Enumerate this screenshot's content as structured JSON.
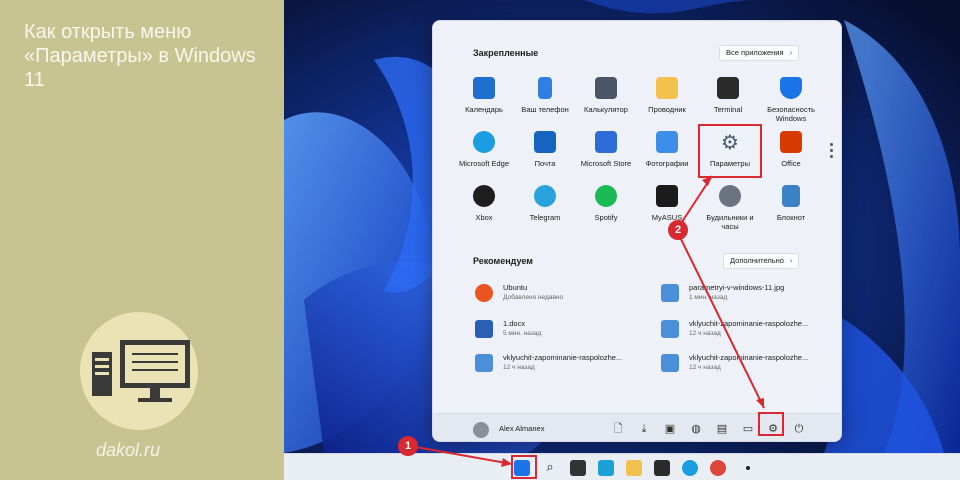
{
  "article": {
    "title": "Как открыть меню «Параметры» в Windows 11",
    "site": "dakol.ru"
  },
  "start_menu": {
    "pinned_title": "Закрепленные",
    "all_apps_label": "Все приложения",
    "pinned_apps": [
      {
        "label": "Календарь",
        "icon": "calendar-icon",
        "color": "#1f6fd1"
      },
      {
        "label": "Ваш телефон",
        "icon": "phone-icon",
        "color": "#2f7fe0"
      },
      {
        "label": "Калькулятор",
        "icon": "calculator-icon",
        "color": "#4a5568"
      },
      {
        "label": "Проводник",
        "icon": "folder-icon",
        "color": "#f2c14e"
      },
      {
        "label": "Terminal",
        "icon": "terminal-icon",
        "color": "#2b2b2b"
      },
      {
        "label": "Безопасность Windows",
        "icon": "shield-icon",
        "color": "#1a73e8"
      },
      {
        "label": "Microsoft Edge",
        "icon": "edge-icon",
        "color": "#1b9de2"
      },
      {
        "label": "Почта",
        "icon": "mail-icon",
        "color": "#1565c0"
      },
      {
        "label": "Microsoft Store",
        "icon": "store-icon",
        "color": "#2d6bd6"
      },
      {
        "label": "Фотографии",
        "icon": "photos-icon",
        "color": "#3d8ee8"
      },
      {
        "label": "Параметры",
        "icon": "gear-icon",
        "color": "#5a6a80"
      },
      {
        "label": "Office",
        "icon": "office-icon",
        "color": "#d83b01"
      },
      {
        "label": "Xbox",
        "icon": "xbox-icon",
        "color": "#1e1e1e"
      },
      {
        "label": "Telegram",
        "icon": "telegram-icon",
        "color": "#2aa3dd"
      },
      {
        "label": "Spotify",
        "icon": "spotify-icon",
        "color": "#1db954"
      },
      {
        "label": "MyASUS",
        "icon": "asus-icon",
        "color": "#1b1b1b"
      },
      {
        "label": "Будильники и часы",
        "icon": "clock-icon",
        "color": "#6b7280"
      },
      {
        "label": "Блокнот",
        "icon": "notepad-icon",
        "color": "#3b82c4"
      }
    ],
    "recommended_title": "Рекомендуем",
    "more_label": "Дополнительно",
    "recommended": [
      {
        "name": "Ubuntu",
        "time": "Добавлено недавно",
        "icon": "ubuntu-icon",
        "color": "#e95420"
      },
      {
        "name": "parametryi-v-windows-11.jpg",
        "time": "1 мин. назад",
        "icon": "image-file-icon",
        "color": "#4a8fd8"
      },
      {
        "name": "1.docx",
        "time": "5 мин. назад",
        "icon": "word-icon",
        "color": "#2b5fb4"
      },
      {
        "name": "vklyuchit-zapominanie-raspolozhe...",
        "time": "12 ч назад",
        "icon": "image-file-icon",
        "color": "#4a8fd8"
      },
      {
        "name": "vklyuchit-zapominanie-raspolozhe...",
        "time": "12 ч назад",
        "icon": "image-file-icon",
        "color": "#4a8fd8"
      },
      {
        "name": "vklyuchit-zapominanie-raspolozhe...",
        "time": "12 ч назад",
        "icon": "image-file-icon",
        "color": "#4a8fd8"
      }
    ],
    "user_name": "Alex Almanex"
  },
  "annotations": {
    "badge1": "1",
    "badge2": "2",
    "highlight_color": "#d9282f"
  }
}
